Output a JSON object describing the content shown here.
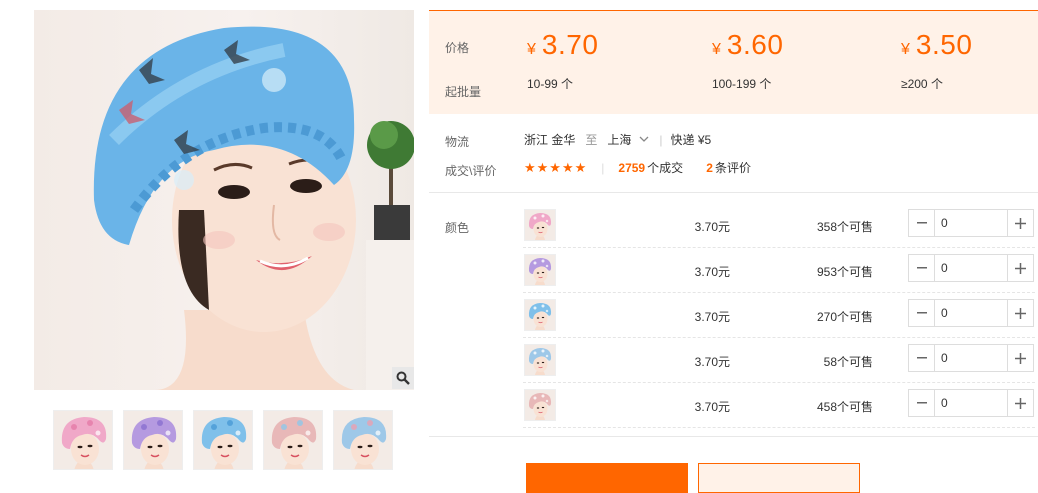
{
  "gallery": {
    "thumbnails": [
      {
        "cap": "#f0a8c8",
        "accent": "#e57aa8"
      },
      {
        "cap": "#b59ae0",
        "accent": "#8a6fd0"
      },
      {
        "cap": "#7fc0ea",
        "accent": "#4a9ad6"
      },
      {
        "cap": "#e8b8b8",
        "accent": "#8fc7e8"
      },
      {
        "cap": "#9ec8e8",
        "accent": "#e8a0b0"
      }
    ]
  },
  "price": {
    "price_label": "价格",
    "moq_label": "起批量",
    "currency": "¥",
    "tiers": [
      {
        "price": "3.70",
        "range": "10-99 个"
      },
      {
        "price": "3.60",
        "range": "100-199 个"
      },
      {
        "price": "3.50",
        "range": "≥200 个"
      }
    ]
  },
  "logistics": {
    "label": "物流",
    "from": "浙江 金华",
    "to_word": "至",
    "to": "上海",
    "method": "快递 ¥5"
  },
  "deals": {
    "label": "成交\\评价",
    "stars": "★★★★★",
    "sold_count": "2759",
    "sold_suffix": "个成交",
    "review_count": "2",
    "review_suffix": "条评价"
  },
  "sku": {
    "label": "颜色",
    "rows": [
      {
        "price": "3.70元",
        "stock": "358个可售",
        "qty": "0",
        "cap": "#f0a8c8"
      },
      {
        "price": "3.70元",
        "stock": "953个可售",
        "qty": "0",
        "cap": "#b59ae0"
      },
      {
        "price": "3.70元",
        "stock": "270个可售",
        "qty": "0",
        "cap": "#7fc0ea"
      },
      {
        "price": "3.70元",
        "stock": "58个可售",
        "qty": "0",
        "cap": "#9ec8e8"
      },
      {
        "price": "3.70元",
        "stock": "458个可售",
        "qty": "0",
        "cap": "#e8b8b8"
      }
    ]
  },
  "colors": {
    "accent": "#ff6600",
    "price_bg": "#fff2e8"
  }
}
